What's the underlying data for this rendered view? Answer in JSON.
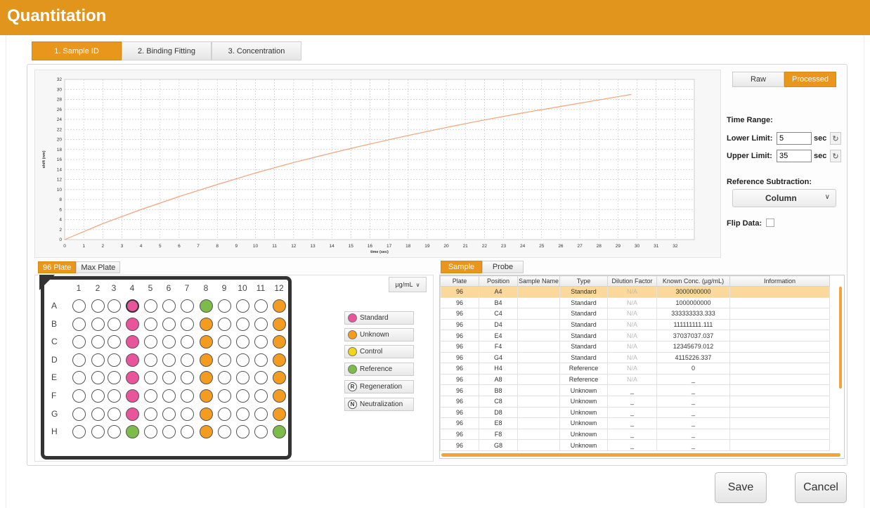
{
  "header": {
    "title": "Quantitation"
  },
  "tabs": [
    "1. Sample ID",
    "2. Binding Fitting",
    "3. Concentration"
  ],
  "view_toggle": {
    "raw": "Raw",
    "processed": "Processed",
    "selected": "Processed"
  },
  "time_range": {
    "title": "Time Range:",
    "lower_label": "Lower Limit:",
    "lower_value": "5",
    "upper_label": "Upper Limit:",
    "upper_value": "35",
    "unit": "sec"
  },
  "reference_subtraction": {
    "title": "Reference Subtraction:",
    "value": "Column"
  },
  "flip_data": {
    "label": "Flip Data:",
    "checked": false
  },
  "plate_tabs": [
    "96 Plate",
    "Max Plate"
  ],
  "plate": {
    "columns": [
      "1",
      "2",
      "3",
      "4",
      "5",
      "6",
      "7",
      "8",
      "9",
      "10",
      "11",
      "12"
    ],
    "rows": [
      "A",
      "B",
      "C",
      "D",
      "E",
      "F",
      "G",
      "H"
    ]
  },
  "unit_select": "µg/mL",
  "legend": {
    "standard": "Standard",
    "unknown": "Unknown",
    "control": "Control",
    "reference": "Reference",
    "regeneration": "Regeneration",
    "neutralization": "Neutralization"
  },
  "colors": {
    "accent": "#e8961c",
    "standard": "#e8559a",
    "unknown": "#f39c1f",
    "control": "#f3d51c",
    "reference": "#7dbb4a"
  },
  "sample_tabs": [
    "Sample",
    "Probe"
  ],
  "table": {
    "headers": [
      "Plate",
      "Position",
      "Sample Name",
      "Type",
      "Dilution Factor",
      "Known Conc. (µg/mL)",
      "Information"
    ],
    "rows": [
      [
        "96",
        "A4",
        "",
        "Standard",
        "N/A",
        "3000000000",
        ""
      ],
      [
        "96",
        "B4",
        "",
        "Standard",
        "N/A",
        "1000000000",
        ""
      ],
      [
        "96",
        "C4",
        "",
        "Standard",
        "N/A",
        "333333333.333",
        ""
      ],
      [
        "96",
        "D4",
        "",
        "Standard",
        "N/A",
        "111111111.111",
        ""
      ],
      [
        "96",
        "E4",
        "",
        "Standard",
        "N/A",
        "37037037.037",
        ""
      ],
      [
        "96",
        "F4",
        "",
        "Standard",
        "N/A",
        "12345679.012",
        ""
      ],
      [
        "96",
        "G4",
        "",
        "Standard",
        "N/A",
        "4115226.337",
        ""
      ],
      [
        "96",
        "H4",
        "",
        "Reference",
        "N/A",
        "0",
        ""
      ],
      [
        "96",
        "A8",
        "",
        "Reference",
        "N/A",
        "_",
        ""
      ],
      [
        "96",
        "B8",
        "",
        "Unknown",
        "_",
        "_",
        ""
      ],
      [
        "96",
        "C8",
        "",
        "Unknown",
        "_",
        "_",
        ""
      ],
      [
        "96",
        "D8",
        "",
        "Unknown",
        "_",
        "_",
        ""
      ],
      [
        "96",
        "E8",
        "",
        "Unknown",
        "_",
        "_",
        ""
      ],
      [
        "96",
        "F8",
        "",
        "Unknown",
        "_",
        "_",
        ""
      ],
      [
        "96",
        "G8",
        "",
        "Unknown",
        "_",
        "_",
        ""
      ]
    ]
  },
  "footer": {
    "save": "Save",
    "cancel": "Cancel"
  },
  "chart_data": {
    "type": "line",
    "xlabel": "time (sec)",
    "ylabel": "shift (nm)",
    "xlim": [
      0,
      33
    ],
    "ylim": [
      0,
      32
    ],
    "x_ticks": [
      0,
      1,
      2,
      3,
      4,
      5,
      6,
      7,
      8,
      9,
      10,
      11,
      12,
      13,
      14,
      15,
      16,
      17,
      18,
      19,
      20,
      21,
      22,
      23,
      24,
      25,
      26,
      27,
      28,
      29,
      30,
      31,
      32
    ],
    "y_ticks": [
      0,
      2,
      4,
      6,
      8,
      10,
      12,
      14,
      16,
      18,
      20,
      22,
      24,
      26,
      28,
      30,
      32
    ],
    "grid": true,
    "series": [
      {
        "color": "#f2a37a",
        "x": [
          0,
          2,
          4,
          6,
          8,
          10,
          12,
          14,
          16,
          18,
          20,
          22,
          24,
          26,
          28,
          29.7
        ],
        "y": [
          0,
          3.2,
          6.0,
          8.6,
          11.0,
          13.3,
          15.4,
          17.3,
          19.1,
          20.8,
          22.4,
          23.9,
          25.3,
          26.6,
          27.9,
          29.0
        ]
      }
    ]
  }
}
